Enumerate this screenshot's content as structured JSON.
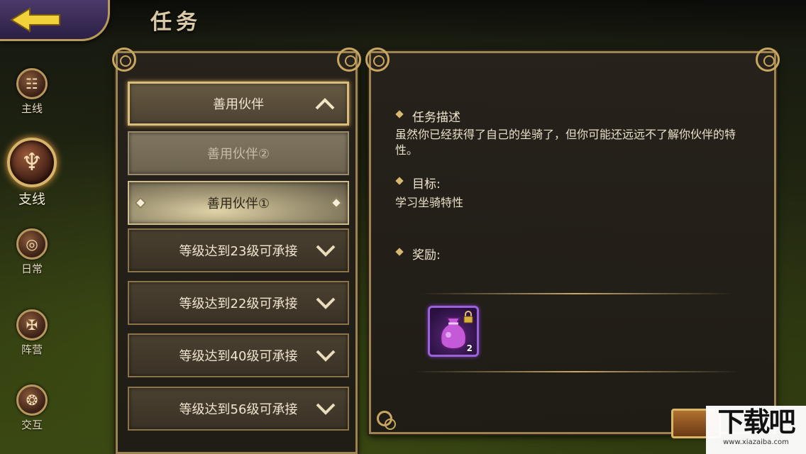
{
  "header": {
    "title": "任务"
  },
  "sidebar": {
    "items": [
      {
        "label": "主线",
        "icon": "scroll-icon"
      },
      {
        "label": "支线",
        "icon": "branch-scroll-icon"
      },
      {
        "label": "日常",
        "icon": "spiral-scroll-icon"
      },
      {
        "label": "阵营",
        "icon": "faction-icon"
      },
      {
        "label": "交互",
        "icon": "interaction-icon"
      }
    ],
    "active_index": 1
  },
  "quest_list": {
    "group_title": "善用伙伴",
    "subquests": [
      "善用伙伴②",
      "善用伙伴①"
    ],
    "locked": [
      "等级达到23级可承接",
      "等级达到22级可承接",
      "等级达到40级可承接",
      "等级达到56级可承接"
    ]
  },
  "detail": {
    "desc_title": "任务描述",
    "desc_text": "虽然你已经获得了自己的坐骑了，但你可能还远远不了解你伙伴的特性。",
    "goal_title": "目标:",
    "goal_text": "学习坐骑特性",
    "reward_title": "奖励:",
    "reward_count": "2"
  },
  "watermark": {
    "main": "下载吧",
    "url": "www.xiazaiba.com"
  },
  "colors": {
    "gold": "#c9a760",
    "reward_border": "#9a62d8"
  }
}
